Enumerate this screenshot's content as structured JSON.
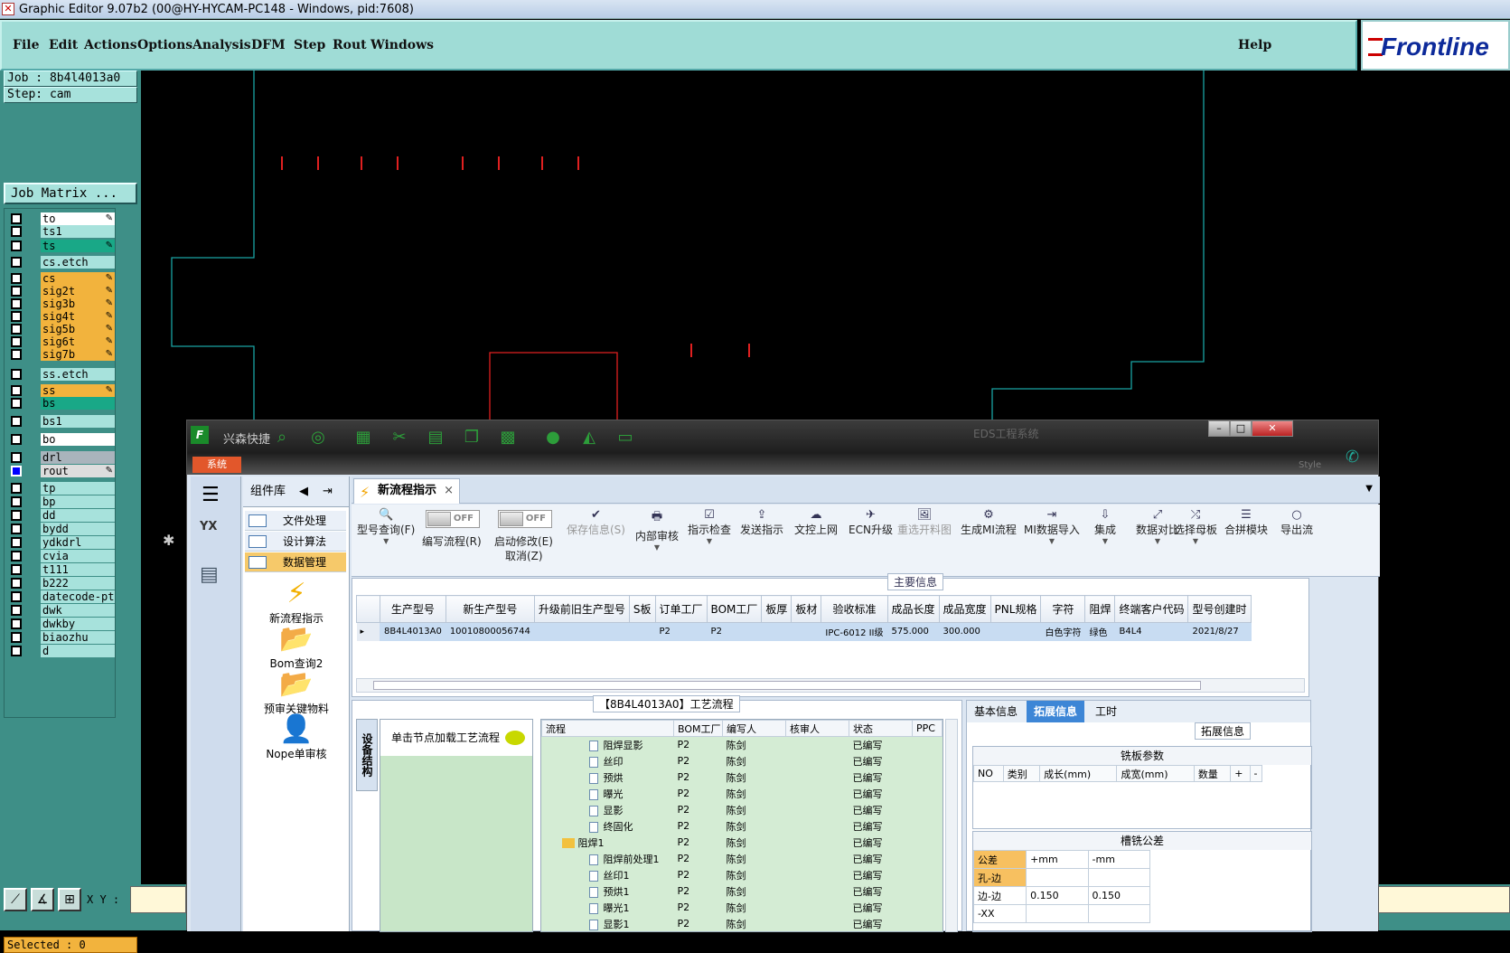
{
  "title_bar": "Graphic Editor 9.07b2 (00@HY-HYCAM-PC148 - Windows, pid:7608)",
  "menu": [
    "File",
    "Edit",
    "Actions",
    "Options",
    "Analysis",
    "DFM",
    "Step",
    "Rout",
    "Windows"
  ],
  "help": "Help",
  "logo": "Frontline",
  "job": "Job : 8b4l4013a0",
  "step": "Step: cam",
  "job_matrix": "Job Matrix ...",
  "layers": [
    {
      "name": "to",
      "color": "#ffffff",
      "edit": true
    },
    {
      "name": "ts1",
      "color": "#a7e2dc",
      "edit": false
    },
    {
      "name": "ts",
      "color": "#19a887",
      "edit": true
    },
    {
      "name": "cs.etch",
      "color": "#a7e2dc",
      "edit": false
    },
    {
      "name": "cs",
      "color": "#f2b33d",
      "edit": true
    },
    {
      "name": "sig2t",
      "color": "#f2b33d",
      "edit": true
    },
    {
      "name": "sig3b",
      "color": "#f2b33d",
      "edit": true
    },
    {
      "name": "sig4t",
      "color": "#f2b33d",
      "edit": true
    },
    {
      "name": "sig5b",
      "color": "#f2b33d",
      "edit": true
    },
    {
      "name": "sig6t",
      "color": "#f2b33d",
      "edit": true
    },
    {
      "name": "sig7b",
      "color": "#f2b33d",
      "edit": true
    },
    {
      "name": "ss.etch",
      "color": "#a7e2dc",
      "edit": false
    },
    {
      "name": "ss",
      "color": "#f2b33d",
      "edit": true
    },
    {
      "name": "bs",
      "color": "#19a887",
      "edit": false
    },
    {
      "name": "bs1",
      "color": "#a7e2dc",
      "edit": false
    },
    {
      "name": "bo",
      "color": "#ffffff",
      "edit": false
    },
    {
      "name": "drl",
      "color": "#a9b4bc",
      "edit": false
    },
    {
      "name": "rout",
      "color": "#dddddd",
      "edit": true
    },
    {
      "name": "tp",
      "color": "#a7e2dc",
      "edit": false
    },
    {
      "name": "bp",
      "color": "#a7e2dc",
      "edit": false
    },
    {
      "name": "dd",
      "color": "#a7e2dc",
      "edit": false
    },
    {
      "name": "bydd",
      "color": "#a7e2dc",
      "edit": false
    },
    {
      "name": "ydkdrl",
      "color": "#a7e2dc",
      "edit": false
    },
    {
      "name": "cvia",
      "color": "#a7e2dc",
      "edit": false
    },
    {
      "name": "t111",
      "color": "#a7e2dc",
      "edit": false
    },
    {
      "name": "b222",
      "color": "#a7e2dc",
      "edit": false
    },
    {
      "name": "datecode-pt",
      "color": "#a7e2dc",
      "edit": false
    },
    {
      "name": "dwk",
      "color": "#a7e2dc",
      "edit": false
    },
    {
      "name": "dwkby",
      "color": "#a7e2dc",
      "edit": false
    },
    {
      "name": "biaozhu",
      "color": "#a7e2dc",
      "edit": false
    },
    {
      "name": "d",
      "color": "#a7e2dc",
      "edit": false
    }
  ],
  "selected": "Selected : 0",
  "xy_label": "X Y :",
  "eds": {
    "quick": "兴森快捷",
    "window_title": "EDS工程系统",
    "sys_tab": "系统",
    "style": "Style",
    "sidebar_header": "组件库",
    "sidebar_items": [
      "文件处理",
      "设计算法",
      "数据管理"
    ],
    "big_icons": [
      {
        "label": "新流程指示",
        "icon": "⚡"
      },
      {
        "label": "Bom查询2",
        "icon": "📂"
      },
      {
        "label": "预审关键物料",
        "icon": "📂"
      },
      {
        "label": "Nope单审核",
        "icon": "👤"
      }
    ],
    "tab": "新流程指示",
    "ribbon": [
      {
        "label": "型号查询(F)",
        "icon": "🔍",
        "dis": false
      },
      {
        "label": "保存信息(S)",
        "icon": "✔",
        "dis": true
      },
      {
        "label": "内部审核",
        "icon": "🖶",
        "dis": false
      },
      {
        "label": "指示检查",
        "icon": "☑",
        "dis": false
      },
      {
        "label": "发送指示",
        "icon": "⇪",
        "dis": false
      },
      {
        "label": "文控上网",
        "icon": "☁",
        "dis": false
      },
      {
        "label": "ECN升级",
        "icon": "✈",
        "dis": false
      },
      {
        "label": "重选开料图",
        "icon": "🖼",
        "dis": true
      },
      {
        "label": "生成MI流程",
        "icon": "⚙",
        "dis": false
      },
      {
        "label": "MI数据导入",
        "icon": "⇥",
        "dis": false
      },
      {
        "label": "集成",
        "icon": "⇩",
        "dis": false
      },
      {
        "label": "数据对比",
        "icon": "⤢",
        "dis": false
      },
      {
        "label": "选择母板",
        "icon": "⤮",
        "dis": false
      },
      {
        "label": "合拼模块",
        "icon": "☰",
        "dis": false
      },
      {
        "label": "导出流",
        "icon": "○",
        "dis": false
      }
    ],
    "toggle_off": "OFF",
    "write_flow": "编写流程(R)",
    "start_modify": "启动修改(E)",
    "cancel": "取消(Z)",
    "main_info_caption": "主要信息",
    "main_cols": [
      "生产型号",
      "新生产型号",
      "升级前旧生产型号",
      "S板",
      "订单工厂",
      "BOM工厂",
      "板厚",
      "板材",
      "验收标准",
      "成品长度",
      "成品宽度",
      "PNL规格",
      "字符",
      "阻焊",
      "终端客户代码",
      "型号创建时"
    ],
    "main_row": [
      "8B4L4013A0",
      "10010800056744",
      "",
      "",
      "P2",
      "P2",
      "",
      "",
      "IPC-6012 II级",
      "575.000",
      "300.000",
      "",
      "白色字符",
      "绿色",
      "B4L4",
      "2021/8/27"
    ],
    "process_caption": "【8B4L4013A0】工艺流程",
    "vtab": "设备结构",
    "click_text": "单击节点加载工艺流程",
    "tree_cols": [
      "流程",
      "BOM工厂",
      "编写人",
      "核审人",
      "状态",
      "PPC"
    ],
    "tree_rows": [
      {
        "name": "阻焊显影",
        "folder": false,
        "indent": 1,
        "factory": "P2",
        "writer": "陈剑",
        "status": "已编写"
      },
      {
        "name": "丝印",
        "folder": false,
        "indent": 1,
        "factory": "P2",
        "writer": "陈剑",
        "status": "已编写"
      },
      {
        "name": "预烘",
        "folder": false,
        "indent": 1,
        "factory": "P2",
        "writer": "陈剑",
        "status": "已编写"
      },
      {
        "name": "曝光",
        "folder": false,
        "indent": 1,
        "factory": "P2",
        "writer": "陈剑",
        "status": "已编写"
      },
      {
        "name": "显影",
        "folder": false,
        "indent": 1,
        "factory": "P2",
        "writer": "陈剑",
        "status": "已编写"
      },
      {
        "name": "终固化",
        "folder": false,
        "indent": 1,
        "factory": "P2",
        "writer": "陈剑",
        "status": "已编写"
      },
      {
        "name": "阻焊1",
        "folder": true,
        "indent": 0,
        "factory": "P2",
        "writer": "陈剑",
        "status": "已编写"
      },
      {
        "name": "阻焊前处理1",
        "folder": false,
        "indent": 1,
        "factory": "P2",
        "writer": "陈剑",
        "status": "已编写"
      },
      {
        "name": "丝印1",
        "folder": false,
        "indent": 1,
        "factory": "P2",
        "writer": "陈剑",
        "status": "已编写"
      },
      {
        "name": "预烘1",
        "folder": false,
        "indent": 1,
        "factory": "P2",
        "writer": "陈剑",
        "status": "已编写"
      },
      {
        "name": "曝光1",
        "folder": false,
        "indent": 1,
        "factory": "P2",
        "writer": "陈剑",
        "status": "已编写"
      },
      {
        "name": "显影1",
        "folder": false,
        "indent": 1,
        "factory": "P2",
        "writer": "陈剑",
        "status": "已编写"
      }
    ],
    "info_tabs": [
      "基本信息",
      "拓展信息",
      "工时"
    ],
    "ext_caption": "拓展信息",
    "milling_title": "铣板参数",
    "milling_cols": [
      "NO",
      "类别",
      "成长(mm)",
      "成宽(mm)",
      "数量",
      "+",
      "-"
    ],
    "slot_title": "槽铣公差",
    "slot_rows": [
      [
        "公差",
        "+mm",
        "-mm"
      ],
      [
        "孔-边",
        "",
        ""
      ],
      [
        "边-边",
        "0.150",
        "0.150"
      ],
      [
        "-XX",
        "",
        ""
      ]
    ]
  }
}
